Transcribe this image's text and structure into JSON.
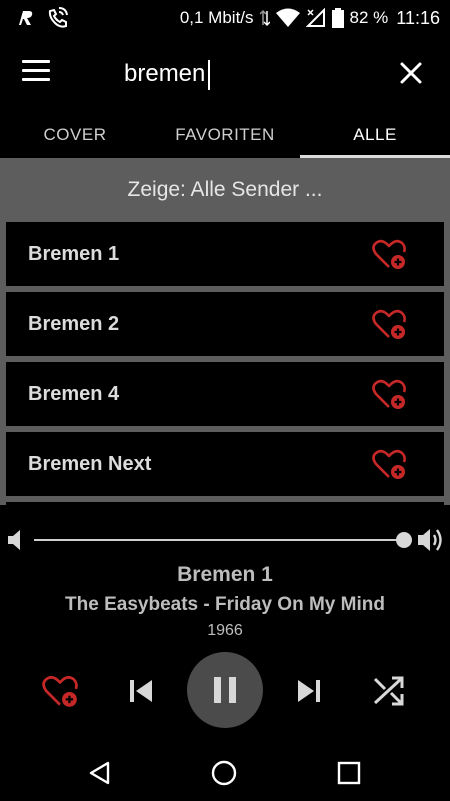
{
  "status_bar": {
    "network_speed": "0,1 Mbit/s",
    "battery_percent": "82 %",
    "time": "11:16",
    "icons": [
      "r-logo-icon",
      "phone-wifi-icon",
      "data-arrows-icon",
      "wifi-icon",
      "mobile-signal-icon",
      "battery-icon"
    ]
  },
  "appbar": {
    "search_value": "bremen",
    "icons": {
      "menu": "hamburger-menu-icon",
      "close": "close-icon"
    }
  },
  "tabs": [
    {
      "label": "COVER",
      "active": false
    },
    {
      "label": "FAVORITEN",
      "active": false
    },
    {
      "label": "ALLE",
      "active": true
    }
  ],
  "list": {
    "header": "Zeige: Alle Sender ...",
    "stations": [
      {
        "name": "Bremen 1"
      },
      {
        "name": "Bremen 2"
      },
      {
        "name": "Bremen 4"
      },
      {
        "name": "Bremen Next"
      }
    ]
  },
  "player": {
    "volume": 0.95,
    "station": "Bremen 1",
    "track": "The Easybeats - Friday On My Mind",
    "year": "1966"
  },
  "colors": {
    "accent_red": "#c62828",
    "list_background": "#5d5d5d",
    "row_background": "#000000",
    "text_grey": "#bdbdbd"
  }
}
